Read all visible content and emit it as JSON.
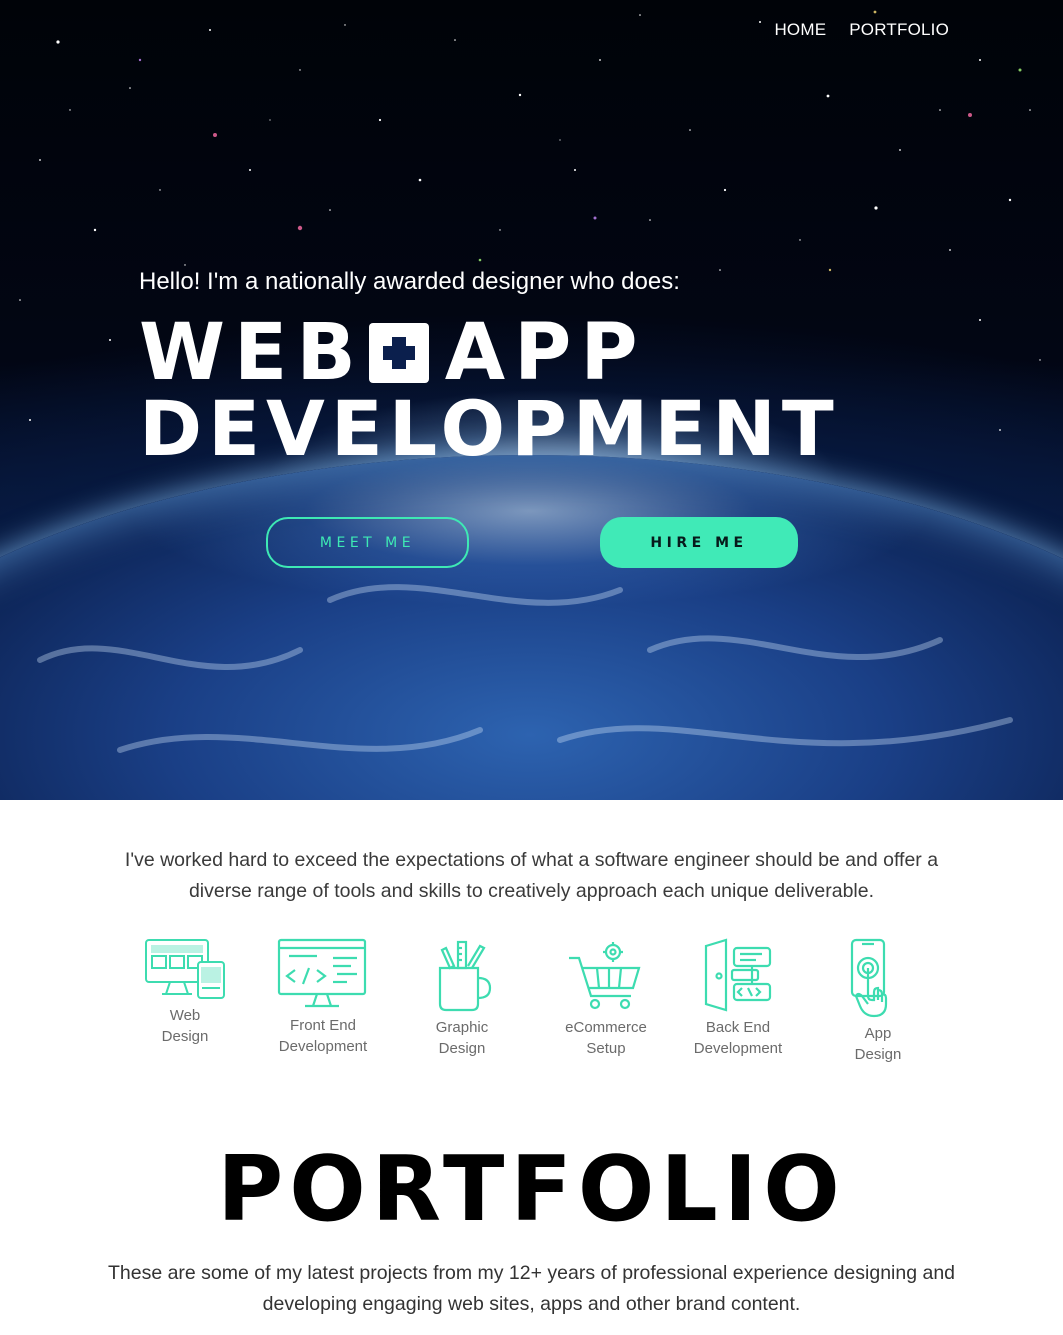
{
  "nav": {
    "items": [
      {
        "label": "HOME"
      },
      {
        "label": "PORTFOLIO"
      }
    ]
  },
  "hero": {
    "intro": "Hello! I'm a nationally awarded designer who does:",
    "headline_line1_left": "WEB",
    "headline_line1_right": "APP",
    "headline_line2": "DEVELOPMENT",
    "meet_button": "MEET ME",
    "hire_button": "HIRE ME"
  },
  "skills": {
    "intro": "I've worked hard to exceed the expectations of what a software engineer should be and offer a diverse range of tools and skills to creatively approach each unique deliverable.",
    "items": [
      {
        "label": "Web\nDesign",
        "icon": "web-design-icon"
      },
      {
        "label": "Front End\nDevelopment",
        "icon": "code-monitor-icon"
      },
      {
        "label": "Graphic\nDesign",
        "icon": "pencil-cup-icon"
      },
      {
        "label": "eCommerce\nSetup",
        "icon": "shopping-cart-icon"
      },
      {
        "label": "Back End\nDevelopment",
        "icon": "server-door-icon"
      },
      {
        "label": "App\nDesign",
        "icon": "phone-tap-icon"
      }
    ]
  },
  "portfolio": {
    "title": "PORTFOLIO",
    "intro": "These are some of my latest projects from my 12+ years of professional experience designing and developing engaging web sites, apps and other brand content."
  },
  "colors": {
    "accent": "#40eab7",
    "icon": "#3ddcb0"
  }
}
